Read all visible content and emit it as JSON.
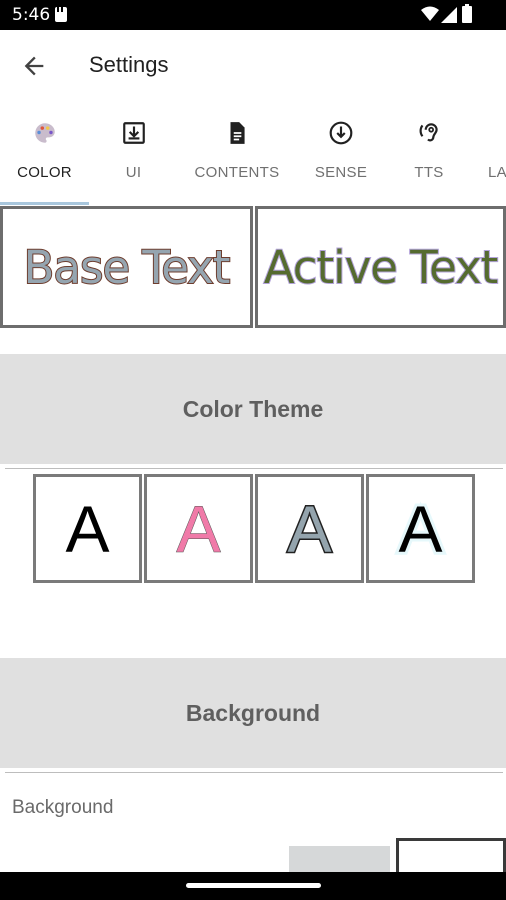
{
  "status_bar": {
    "time": "5:46"
  },
  "app_bar": {
    "title": "Settings"
  },
  "tabs": [
    {
      "label": "COLOR",
      "icon": "palette-icon",
      "active": true
    },
    {
      "label": "UI",
      "icon": "download-box-icon",
      "active": false
    },
    {
      "label": "CONTENTS",
      "icon": "document-icon",
      "active": false
    },
    {
      "label": "SENSE",
      "icon": "arrow-down-circle-icon",
      "active": false
    },
    {
      "label": "TTS",
      "icon": "hearing-icon",
      "active": false
    },
    {
      "label": "LA",
      "icon": "",
      "active": false
    }
  ],
  "previews": {
    "base_text": "Base Text",
    "active_text": "Active Text"
  },
  "sections": {
    "color_theme": "Color Theme",
    "background": "Background"
  },
  "color_themes": [
    {
      "letter": "A",
      "fill": "#000000",
      "stroke": "none"
    },
    {
      "letter": "A",
      "fill": "#f07aa8",
      "stroke": "#555555"
    },
    {
      "letter": "A",
      "fill": "#94a4ad",
      "stroke": "#222222"
    },
    {
      "letter": "A",
      "fill": "#000000",
      "stroke": "#e6f8fb"
    }
  ],
  "background_field": {
    "label": "Background"
  },
  "colors": {
    "base_text_fill": "#95a5b0",
    "base_text_outline": "#6e3d2e",
    "active_text_fill": "#556b2f",
    "active_text_outline": "#b3a3d9",
    "tab_indicator": "#a9c7dd",
    "section_bg": "#e0e0e0"
  }
}
